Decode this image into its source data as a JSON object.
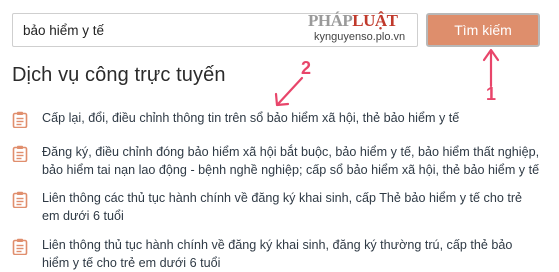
{
  "search": {
    "value": "bảo hiểm y tế",
    "button_label": "Tìm kiếm"
  },
  "watermark": {
    "brand_left": "PHÁP",
    "brand_right": "LUẬT",
    "url": "kynguyenso.plo.vn"
  },
  "section": {
    "title": "Dịch vụ công trực tuyến",
    "items": [
      {
        "lines": [
          "Cấp lại, đổi, điều chỉnh thông tin trên sổ bảo hiểm xã hội, thẻ bảo hiểm y tế"
        ]
      },
      {
        "lines": [
          "Đăng ký, điều chỉnh đóng bảo hiểm xã hội bắt buộc, bảo hiểm y tế, bảo hiểm thất nghiệp,",
          "bảo hiểm tai nạn lao động - bệnh nghề nghiệp; cấp sổ bảo hiểm xã hội, thẻ bảo hiểm y tế"
        ]
      },
      {
        "lines": [
          "Liên thông các thủ tục hành chính về đăng ký khai sinh, cấp Thẻ bảo hiểm y tế cho trẻ",
          "em dưới 6 tuổi"
        ]
      },
      {
        "lines": [
          "Liên thông thủ tục hành chính về đăng ký khai sinh, đăng ký thường trú, cấp thẻ bảo",
          "hiểm y tế cho trẻ em dưới 6 tuổi"
        ]
      }
    ]
  },
  "annotations": {
    "marker_1": "1",
    "marker_2": "2",
    "color": "#e8456a"
  },
  "colors": {
    "button_bg": "#de8e6c",
    "icon": "#e08e6d"
  }
}
